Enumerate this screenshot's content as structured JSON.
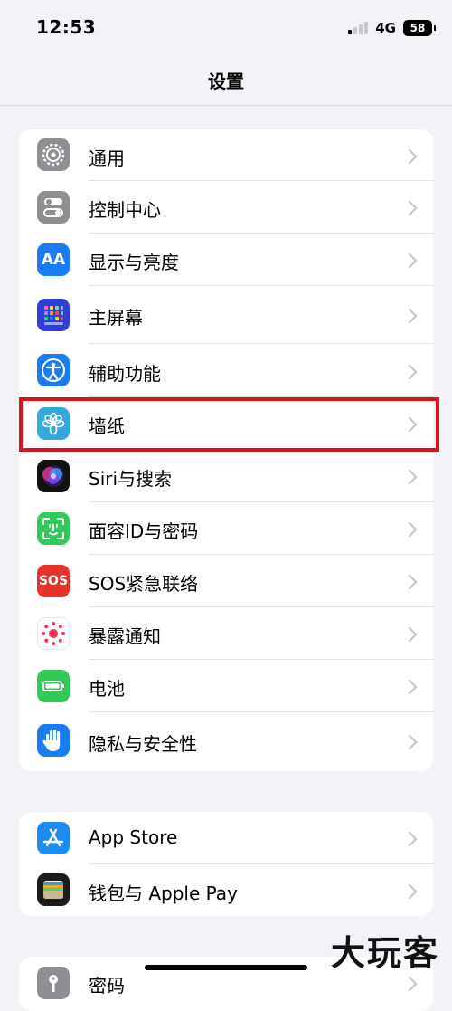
{
  "status_bar": {
    "time": "12:53",
    "network": "4G",
    "battery": "58"
  },
  "nav": {
    "title": "设置"
  },
  "groups": [
    [
      {
        "label": "通用",
        "icon": "gear-icon",
        "color": "#8e8e93"
      },
      {
        "label": "控制中心",
        "icon": "toggles-icon",
        "color": "#8e8e93"
      },
      {
        "label": "显示与亮度",
        "icon": "text-size-icon",
        "color": "#1a7cf5",
        "icon_text": "AA"
      },
      {
        "label": "主屏幕",
        "icon": "home-screen-grid-icon",
        "color": "#2f3fd6"
      },
      {
        "label": "辅助功能",
        "icon": "accessibility-icon",
        "color": "#1a7cf5"
      },
      {
        "label": "墙纸",
        "icon": "flower-icon",
        "color": "#34aadc"
      },
      {
        "label": "Siri与搜索",
        "icon": "siri-icon",
        "color": "#111111"
      },
      {
        "label": "面容ID与密码",
        "icon": "face-id-icon",
        "color": "#34c759"
      },
      {
        "label": "SOS紧急联络",
        "icon": "sos-icon",
        "color": "#e5332a",
        "icon_text": "SOS"
      },
      {
        "label": "暴露通知",
        "icon": "exposure-icon",
        "color": "#ffffff"
      },
      {
        "label": "电池",
        "icon": "battery-icon",
        "color": "#34c759"
      },
      {
        "label": "隐私与安全性",
        "icon": "hand-icon",
        "color": "#1a7cf5"
      }
    ],
    [
      {
        "label": "App Store",
        "icon": "app-store-icon",
        "color": "#1a8cf5"
      },
      {
        "label": "钱包与 Apple Pay",
        "icon": "wallet-icon",
        "color": "#1c1c1e"
      }
    ],
    [
      {
        "label": "密码",
        "icon": "key-icon",
        "color": "#8e8e93"
      }
    ]
  ],
  "watermark": "大玩客"
}
